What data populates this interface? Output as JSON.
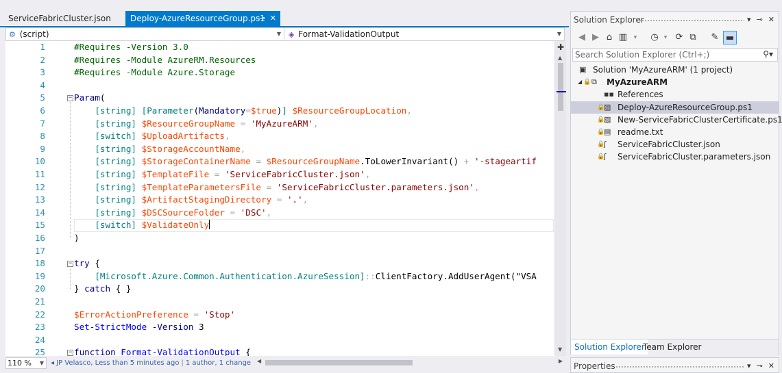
{
  "tabs": [
    {
      "label": "ServiceFabricCluster.json"
    },
    {
      "label": "Deploy-AzureResourceGroup.ps1",
      "pin": "⊸",
      "close": "✕"
    }
  ],
  "navbar": {
    "scope": "(script)",
    "member": "Format-ValidationOutput"
  },
  "editor": {
    "lines": [
      {
        "n": "1",
        "tokens": [
          [
            "c-cmt",
            "#Requires -Version 3.0"
          ]
        ]
      },
      {
        "n": "2",
        "tokens": [
          [
            "c-cmt",
            "#Requires -Module AzureRM.Resources"
          ]
        ]
      },
      {
        "n": "3",
        "tokens": [
          [
            "c-cmt",
            "#Requires -Module Azure.Storage"
          ]
        ]
      },
      {
        "n": "4",
        "tokens": []
      },
      {
        "n": "5",
        "fold": "−",
        "tokens": [
          [
            "c-kw",
            "Param"
          ],
          [
            "c-pl",
            "("
          ]
        ]
      },
      {
        "n": "6",
        "tokens": [
          [
            "c-pl",
            "    "
          ],
          [
            "c-type",
            "[string]"
          ],
          [
            "c-pl",
            " "
          ],
          [
            "c-type",
            "[Parameter"
          ],
          [
            "c-pl",
            "("
          ],
          [
            "c-par",
            "Mandatory"
          ],
          [
            "c-op",
            "="
          ],
          [
            "c-var",
            "$true"
          ],
          [
            "c-pl",
            ")"
          ],
          [
            "c-type",
            "]"
          ],
          [
            "c-pl",
            " "
          ],
          [
            "c-var",
            "$ResourceGroupLocation"
          ],
          [
            "c-op",
            ","
          ]
        ]
      },
      {
        "n": "7",
        "tokens": [
          [
            "c-pl",
            "    "
          ],
          [
            "c-type",
            "[string]"
          ],
          [
            "c-pl",
            " "
          ],
          [
            "c-var",
            "$ResourceGroupName"
          ],
          [
            "c-pl",
            " "
          ],
          [
            "c-op",
            "="
          ],
          [
            "c-pl",
            " "
          ],
          [
            "c-str",
            "'MyAzureARM'"
          ],
          [
            "c-op",
            ","
          ]
        ]
      },
      {
        "n": "8",
        "tokens": [
          [
            "c-pl",
            "    "
          ],
          [
            "c-type",
            "[switch]"
          ],
          [
            "c-pl",
            " "
          ],
          [
            "c-var",
            "$UploadArtifacts"
          ],
          [
            "c-op",
            ","
          ]
        ]
      },
      {
        "n": "9",
        "tokens": [
          [
            "c-pl",
            "    "
          ],
          [
            "c-type",
            "[string]"
          ],
          [
            "c-pl",
            " "
          ],
          [
            "c-var",
            "$StorageAccountName"
          ],
          [
            "c-op",
            ","
          ]
        ]
      },
      {
        "n": "10",
        "tokens": [
          [
            "c-pl",
            "    "
          ],
          [
            "c-type",
            "[string]"
          ],
          [
            "c-pl",
            " "
          ],
          [
            "c-var",
            "$StorageContainerName"
          ],
          [
            "c-pl",
            " "
          ],
          [
            "c-op",
            "="
          ],
          [
            "c-pl",
            " "
          ],
          [
            "c-var",
            "$ResourceGroupName"
          ],
          [
            "c-pl",
            ".ToLowerInvariant() "
          ],
          [
            "c-op",
            "+"
          ],
          [
            "c-pl",
            " "
          ],
          [
            "c-str",
            "'-stageartif"
          ]
        ]
      },
      {
        "n": "11",
        "tokens": [
          [
            "c-pl",
            "    "
          ],
          [
            "c-type",
            "[string]"
          ],
          [
            "c-pl",
            " "
          ],
          [
            "c-var",
            "$TemplateFile"
          ],
          [
            "c-pl",
            " "
          ],
          [
            "c-op",
            "="
          ],
          [
            "c-pl",
            " "
          ],
          [
            "c-str",
            "'ServiceFabricCluster.json'"
          ],
          [
            "c-op",
            ","
          ]
        ]
      },
      {
        "n": "12",
        "tokens": [
          [
            "c-pl",
            "    "
          ],
          [
            "c-type",
            "[string]"
          ],
          [
            "c-pl",
            " "
          ],
          [
            "c-var",
            "$TemplateParametersFile"
          ],
          [
            "c-pl",
            " "
          ],
          [
            "c-op",
            "="
          ],
          [
            "c-pl",
            " "
          ],
          [
            "c-str",
            "'ServiceFabricCluster.parameters.json'"
          ],
          [
            "c-op",
            ","
          ]
        ]
      },
      {
        "n": "13",
        "tokens": [
          [
            "c-pl",
            "    "
          ],
          [
            "c-type",
            "[string]"
          ],
          [
            "c-pl",
            " "
          ],
          [
            "c-var",
            "$ArtifactStagingDirectory"
          ],
          [
            "c-pl",
            " "
          ],
          [
            "c-op",
            "="
          ],
          [
            "c-pl",
            " "
          ],
          [
            "c-str",
            "'.'"
          ],
          [
            "c-op",
            ","
          ]
        ]
      },
      {
        "n": "14",
        "tokens": [
          [
            "c-pl",
            "    "
          ],
          [
            "c-type",
            "[string]"
          ],
          [
            "c-pl",
            " "
          ],
          [
            "c-var",
            "$DSCSourceFolder"
          ],
          [
            "c-pl",
            " "
          ],
          [
            "c-op",
            "="
          ],
          [
            "c-pl",
            " "
          ],
          [
            "c-str",
            "'DSC'"
          ],
          [
            "c-op",
            ","
          ]
        ]
      },
      {
        "n": "15",
        "current": true,
        "tokens": [
          [
            "c-pl",
            "    "
          ],
          [
            "c-type",
            "[switch]"
          ],
          [
            "c-pl",
            " "
          ],
          [
            "c-var",
            "$ValidateOnly"
          ]
        ]
      },
      {
        "n": "16",
        "tokens": [
          [
            "c-pl",
            ")"
          ]
        ]
      },
      {
        "n": "17",
        "tokens": []
      },
      {
        "n": "18",
        "fold": "−",
        "tokens": [
          [
            "c-kw",
            "try"
          ],
          [
            "c-pl",
            " {"
          ]
        ]
      },
      {
        "n": "19",
        "tokens": [
          [
            "c-pl",
            "    "
          ],
          [
            "c-type",
            "[Microsoft.Azure.Common.Authentication.AzureSession]"
          ],
          [
            "c-op",
            "::"
          ],
          [
            "c-pl",
            "ClientFactory.AddUserAgent(\"VSA"
          ]
        ]
      },
      {
        "n": "20",
        "tokens": [
          [
            "c-pl",
            "} "
          ],
          [
            "c-kw",
            "catch"
          ],
          [
            "c-pl",
            " { }"
          ]
        ]
      },
      {
        "n": "21",
        "tokens": []
      },
      {
        "n": "22",
        "tokens": [
          [
            "c-var",
            "$ErrorActionPreference"
          ],
          [
            "c-pl",
            " "
          ],
          [
            "c-op",
            "="
          ],
          [
            "c-pl",
            " "
          ],
          [
            "c-str",
            "'Stop'"
          ]
        ]
      },
      {
        "n": "23",
        "tokens": [
          [
            "c-fn",
            "Set-StrictMode"
          ],
          [
            "c-pl",
            " "
          ],
          [
            "c-par",
            "-Version"
          ],
          [
            "c-pl",
            " 3"
          ]
        ]
      },
      {
        "n": "24",
        "tokens": []
      },
      {
        "n": "25",
        "fold": "−",
        "tokens": [
          [
            "c-kw",
            "function"
          ],
          [
            "c-pl",
            " "
          ],
          [
            "c-fn",
            "Format-ValidationOutput"
          ],
          [
            "c-pl",
            " {"
          ]
        ]
      }
    ]
  },
  "bottombar": {
    "zoom": "110 %",
    "codelens_author": "JP Velasco, Less than 5 minutes ago",
    "codelens_changes": "1 author, 1 change"
  },
  "solution_explorer": {
    "title": "Solution Explorer",
    "search_placeholder": "Search Solution Explorer (Ctrl+;)",
    "tree": [
      {
        "label": "Solution 'MyAzureARM' (1 project)",
        "indent": 0,
        "icon": "solution-icon",
        "glyph": "▣"
      },
      {
        "label": "MyAzureARM",
        "indent": 1,
        "icon": "project-icon",
        "glyph": "⧉",
        "bold": true,
        "expand": "◢",
        "lock": "🔒"
      },
      {
        "label": "References",
        "indent": 2,
        "icon": "references-icon",
        "glyph": "▪▪"
      },
      {
        "label": "Deploy-AzureResourceGroup.ps1",
        "indent": 2,
        "icon": "ps1-file-icon",
        "glyph": "▨",
        "lock": "🔒",
        "selected": true
      },
      {
        "label": "New-ServiceFabricClusterCertificate.ps1",
        "indent": 2,
        "icon": "ps1-file-icon",
        "glyph": "▨",
        "lock": "🔒"
      },
      {
        "label": "readme.txt",
        "indent": 2,
        "icon": "text-file-icon",
        "glyph": "▤",
        "lock": "🔒"
      },
      {
        "label": "ServiceFabricCluster.json",
        "indent": 2,
        "icon": "json-file-icon",
        "glyph": "ʃ",
        "lock": "🔒"
      },
      {
        "label": "ServiceFabricCluster.parameters.json",
        "indent": 2,
        "icon": "json-file-icon",
        "glyph": "ʃ",
        "lock": "🔒"
      }
    ],
    "tabs": [
      {
        "label": "Solution Explorer"
      },
      {
        "label": "Team Explorer"
      }
    ]
  },
  "properties": {
    "title": "Properties"
  },
  "panel_buttons": {
    "dropdown": "▾",
    "pin": "⊸",
    "close": "✕"
  },
  "colors": {
    "accent": "#007acc",
    "selection": "#cccedb"
  }
}
